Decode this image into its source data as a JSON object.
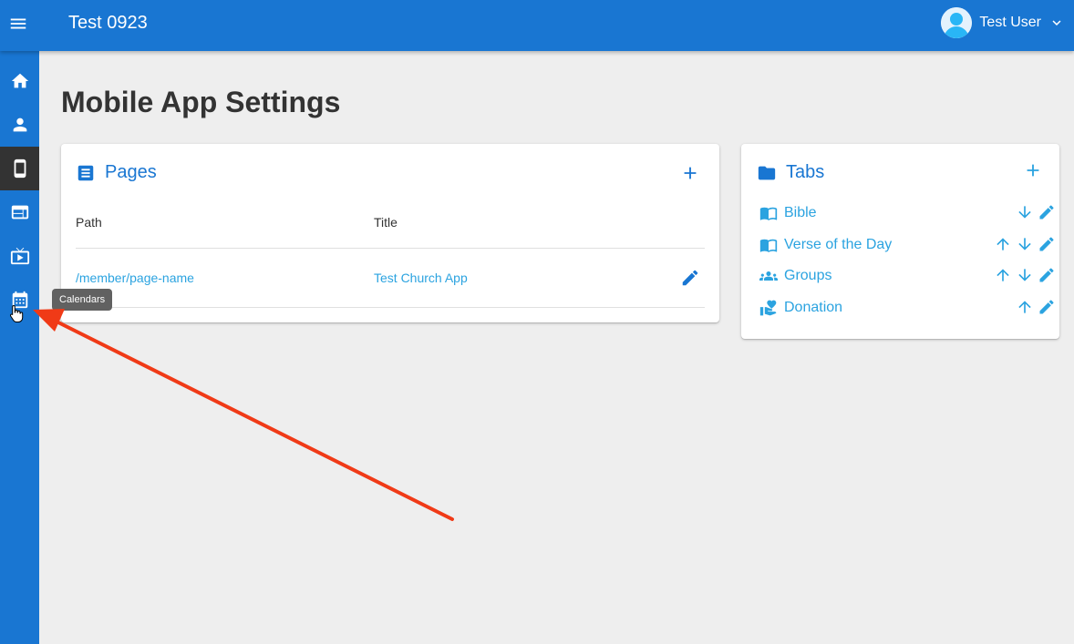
{
  "topbar": {
    "app_title": "Test 0923",
    "user_name": "Test User",
    "icons": {
      "menu": "menu-icon",
      "avatar": "account-circle-icon",
      "dropdown": "chevron-down-icon"
    }
  },
  "sidebar": {
    "items": [
      {
        "icon": "home-icon",
        "active": false
      },
      {
        "icon": "person-icon",
        "active": false
      },
      {
        "icon": "smartphone-icon",
        "active": true
      },
      {
        "icon": "web-icon",
        "active": false
      },
      {
        "icon": "live-tv-icon",
        "active": false
      },
      {
        "icon": "calendar-icon",
        "active": false,
        "tooltip": "Calendars"
      }
    ]
  },
  "main": {
    "page_title": "Mobile App Settings",
    "pages_card": {
      "title": "Pages",
      "icon": "description-icon",
      "columns": [
        "Path",
        "Title"
      ],
      "rows": [
        {
          "path": "/member/page-name",
          "title": "Test Church App"
        }
      ]
    },
    "tabs_card": {
      "title": "Tabs",
      "icon": "folder-icon",
      "items": [
        {
          "label": "Bible",
          "icon": "menu-book-icon",
          "up": false,
          "down": true
        },
        {
          "label": "Verse of the Day",
          "icon": "menu-book-icon",
          "up": true,
          "down": true
        },
        {
          "label": "Groups",
          "icon": "groups-icon",
          "up": true,
          "down": true
        },
        {
          "label": "Donation",
          "icon": "volunteer-activism-icon",
          "up": true,
          "down": false
        }
      ]
    }
  },
  "colors": {
    "primary": "#1976d2",
    "link": "#2ba3e0",
    "sidebar_active": "#333333",
    "background": "#eeeeee",
    "annotation_arrow": "#f03a17"
  }
}
